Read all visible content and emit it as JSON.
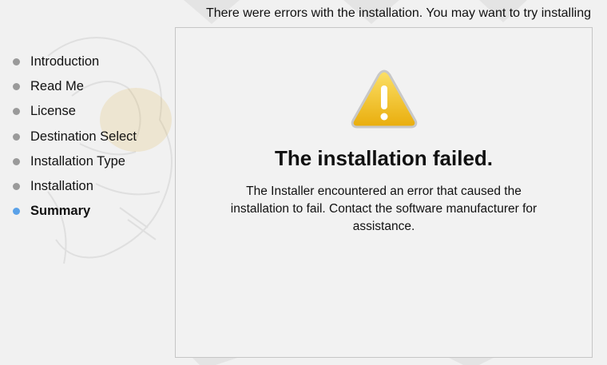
{
  "window": {
    "top_message": "There were errors with the installation. You may want to try installing"
  },
  "sidebar": {
    "steps": [
      {
        "label": "Introduction",
        "state": "done"
      },
      {
        "label": "Read Me",
        "state": "done"
      },
      {
        "label": "License",
        "state": "done"
      },
      {
        "label": "Destination Select",
        "state": "done"
      },
      {
        "label": "Installation Type",
        "state": "done"
      },
      {
        "label": "Installation",
        "state": "done"
      },
      {
        "label": "Summary",
        "state": "current"
      }
    ]
  },
  "result": {
    "icon": "warning-triangle-icon",
    "title": "The installation failed.",
    "message": "The Installer encountered an error that caused the installation to fail. Contact the software manufacturer for assistance."
  },
  "colors": {
    "current_step_dot": "#5aa1e8",
    "done_step_dot": "#9a9a9a",
    "warning_yellow": "#f2c11d"
  }
}
